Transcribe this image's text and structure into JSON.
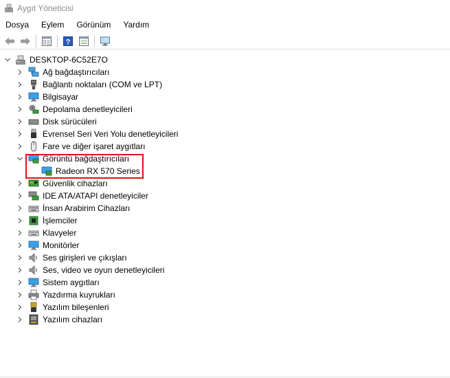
{
  "window": {
    "title": "Aygıt Yöneticisi",
    "icon": "device-manager-icon"
  },
  "menu": {
    "file": "Dosya",
    "action": "Eylem",
    "view": "Görünüm",
    "help": "Yardım"
  },
  "toolbar": {
    "buttons": [
      "back-arrow-icon",
      "forward-arrow-icon",
      "properties-icon",
      "help-icon",
      "view-resources-icon",
      "monitor-icon"
    ]
  },
  "tree": {
    "root": "DESKTOP-6C52E7O",
    "categories": [
      {
        "label": "Ağ bağdaştırıcıları",
        "icon": "network-adapter-icon"
      },
      {
        "label": "Bağlantı noktaları (COM ve LPT)",
        "icon": "port-icon"
      },
      {
        "label": "Bilgisayar",
        "icon": "computer-icon"
      },
      {
        "label": "Depolama denetleyicileri",
        "icon": "storage-controller-icon"
      },
      {
        "label": "Disk sürücüleri",
        "icon": "disk-drive-icon"
      },
      {
        "label": "Evrensel Seri Veri Yolu denetleyicileri",
        "icon": "usb-icon"
      },
      {
        "label": "Fare ve diğer işaret aygıtları",
        "icon": "mouse-icon"
      },
      {
        "label": "Görüntü bağdaştırıcıları",
        "icon": "display-adapter-icon",
        "expanded": true
      },
      {
        "label": "Güvenlik cihazları",
        "icon": "security-device-icon"
      },
      {
        "label": "IDE ATA/ATAPI denetleyiciler",
        "icon": "ide-controller-icon"
      },
      {
        "label": "İnsan Arabirim Cihazları",
        "icon": "hid-icon"
      },
      {
        "label": "İşlemciler",
        "icon": "processor-icon"
      },
      {
        "label": "Klavyeler",
        "icon": "keyboard-icon"
      },
      {
        "label": "Monitörler",
        "icon": "monitor-icon"
      },
      {
        "label": "Ses girişleri ve çıkışları",
        "icon": "speaker-icon"
      },
      {
        "label": "Ses, video ve oyun denetleyicileri",
        "icon": "sound-controller-icon"
      },
      {
        "label": "Sistem aygıtları",
        "icon": "system-device-icon"
      },
      {
        "label": "Yazdırma kuyrukları",
        "icon": "printer-icon"
      },
      {
        "label": "Yazılım bileşenleri",
        "icon": "software-component-icon"
      },
      {
        "label": "Yazılım cihazları",
        "icon": "software-device-icon"
      }
    ],
    "display_child": {
      "label": "Radeon RX 570 Series",
      "icon": "display-adapter-icon"
    }
  },
  "colors": {
    "highlight_border": "#e01010",
    "title_text": "#8a8a8a",
    "chevron": "#555555"
  }
}
